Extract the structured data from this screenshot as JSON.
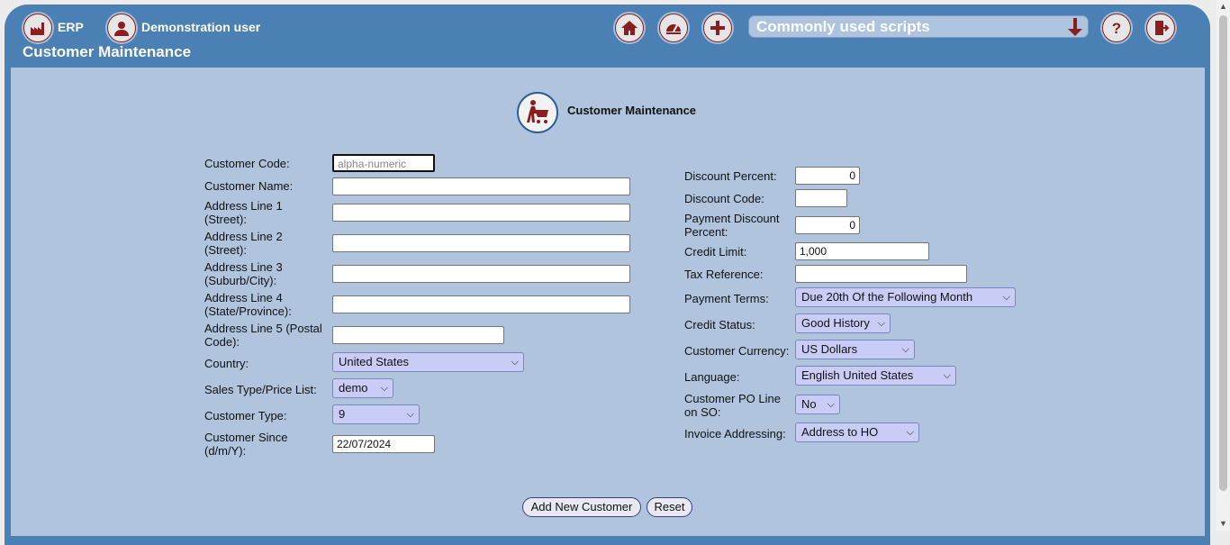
{
  "header": {
    "app_name": "ERP",
    "user_name": "Demonstration user",
    "page_title": "Customer Maintenance",
    "scripts_dropdown": "Commonly used scripts"
  },
  "form": {
    "title": "Customer Maintenance",
    "left": {
      "customer_code": {
        "label": "Customer Code:",
        "placeholder": "alpha-numeric",
        "value": ""
      },
      "customer_name": {
        "label": "Customer Name:",
        "value": ""
      },
      "address1": {
        "label_line1": "Address Line 1",
        "label_line2": "(Street):",
        "value": ""
      },
      "address2": {
        "label_line1": "Address Line 2",
        "label_line2": "(Street):",
        "value": ""
      },
      "address3": {
        "label_line1": "Address Line 3",
        "label_line2": "(Suburb/City):",
        "value": ""
      },
      "address4": {
        "label_line1": "Address Line 4",
        "label_line2": "(State/Province):",
        "value": ""
      },
      "address5": {
        "label_line1": "Address Line 5 (Postal",
        "label_line2": "Code):",
        "value": ""
      },
      "country": {
        "label": "Country:",
        "value": "United States"
      },
      "sales_type": {
        "label": "Sales Type/Price List:",
        "value": "demo"
      },
      "customer_type": {
        "label": "Customer Type:",
        "value": "9"
      },
      "customer_since": {
        "label_line1": "Customer Since",
        "label_line2": "(d/m/Y):",
        "value": "22/07/2024"
      }
    },
    "right": {
      "discount_percent": {
        "label": "Discount Percent:",
        "value": "0"
      },
      "discount_code": {
        "label": "Discount Code:",
        "value": ""
      },
      "payment_discount": {
        "label_line1": "Payment Discount",
        "label_line2": "Percent:",
        "value": "0"
      },
      "credit_limit": {
        "label": "Credit Limit:",
        "value": "1,000"
      },
      "tax_reference": {
        "label": "Tax Reference:",
        "value": ""
      },
      "payment_terms": {
        "label": "Payment Terms:",
        "value": "Due 20th Of the Following Month"
      },
      "credit_status": {
        "label": "Credit Status:",
        "value": "Good History"
      },
      "currency": {
        "label": "Customer Currency:",
        "value": "US Dollars"
      },
      "language": {
        "label": "Language:",
        "value": "English United States"
      },
      "po_line": {
        "label_line1": "Customer PO Line",
        "label_line2": "on SO:",
        "value": "No"
      },
      "invoice_addressing": {
        "label": "Invoice Addressing:",
        "value": "Address to HO"
      }
    },
    "buttons": {
      "add": "Add New Customer",
      "reset": "Reset"
    }
  },
  "colors": {
    "header_bg": "#4a80b3",
    "content_bg": "#b0c4de",
    "icon_red": "#8a1d1d"
  },
  "icons": [
    "factory-icon",
    "user-icon",
    "home-icon",
    "dashboard-icon",
    "plus-icon",
    "down-arrow-icon",
    "help-icon",
    "logout-icon",
    "customer-cart-icon"
  ]
}
